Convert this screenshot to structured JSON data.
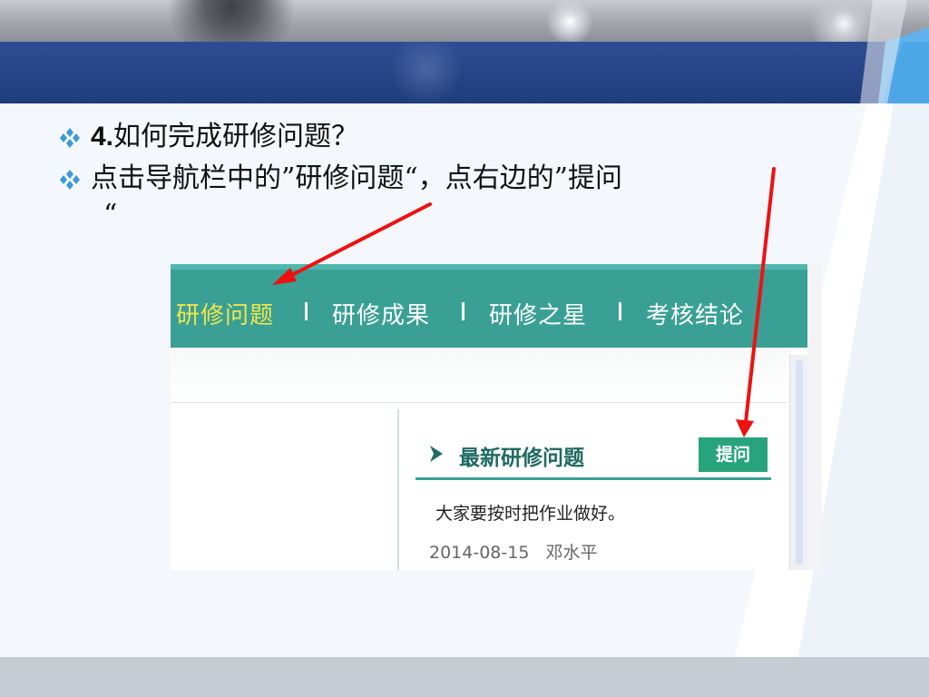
{
  "slide": {
    "bullets": [
      {
        "number": "4.",
        "text": "如何完成研修问题？"
      },
      {
        "text": "点击导航栏中的”研修问题“，点右边的”提问",
        "continuation": "“"
      }
    ]
  },
  "screenshot": {
    "nav": [
      {
        "label": "研修问题",
        "active": true
      },
      {
        "label": "研修成果",
        "active": false
      },
      {
        "label": "研修之星",
        "active": false
      },
      {
        "label": "考核结论",
        "active": false
      }
    ],
    "nav_separator": "|",
    "panel": {
      "title": "最新研修问题",
      "ask_button": "提问",
      "question": "大家要按时把作业做好。",
      "date": "2014-08-15",
      "author": "邓水平"
    }
  },
  "colors": {
    "header_band": "#264485",
    "nav_teal": "#3aa095",
    "nav_active": "#f0e64a",
    "ask_button": "#27a47c",
    "arrow": "#ee1111",
    "bullet_marker": "#3c9ad6"
  },
  "icons": {
    "bullet": "diamond-4-icon",
    "panel": "chevron-right-icon"
  }
}
